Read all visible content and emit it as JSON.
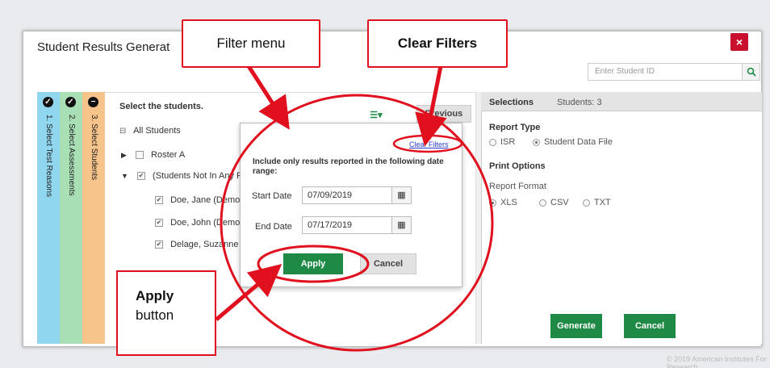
{
  "modal": {
    "title": "Student Results Generat",
    "close_label": "×",
    "search_placeholder": "Enter Student ID"
  },
  "steps": [
    {
      "num": "✓",
      "label": "1. Select Test Reasons"
    },
    {
      "num": "✓",
      "label": "2. Select Assessments"
    },
    {
      "num": "−",
      "label": "3. Select Students"
    }
  ],
  "students": {
    "heading": "Select the students.",
    "all_students": "All Students",
    "roster_a": "Roster A",
    "not_in_roster": "(Students Not In Any R",
    "names": [
      "Doe, Jane (DemoS",
      "Doe, John (DemoS",
      "Delage, Suzanne ("
    ],
    "previous_label": "Previous"
  },
  "filter": {
    "clear_filters": "Clear Filters",
    "instruction": "Include only results reported in the following date range:",
    "start_label": "Start Date",
    "start_value": "07/09/2019",
    "end_label": "End Date",
    "end_value": "07/17/2019",
    "apply_label": "Apply",
    "cancel_label": "Cancel"
  },
  "selections": {
    "tab_label": "Selections",
    "students_count": "Students: 3",
    "report_type_label": "Report Type",
    "report_types": [
      "ISR",
      "Student Data File"
    ],
    "print_options_label": "Print Options",
    "report_format_label": "Report Format",
    "formats": [
      "XLS",
      "CSV",
      "TXT"
    ],
    "generate_label": "Generate",
    "cancel_label": "Cancel"
  },
  "callouts": {
    "filter_menu": "Filter menu",
    "clear_filters": "Clear Filters",
    "apply_line1": "Apply",
    "apply_line2": "button"
  },
  "footer": {
    "copyright": "© 2019 American Institutes For Research"
  },
  "colors": {
    "callout_red": "#e0101e",
    "green_button": "#1e8a45",
    "close_red": "#c8102e"
  }
}
